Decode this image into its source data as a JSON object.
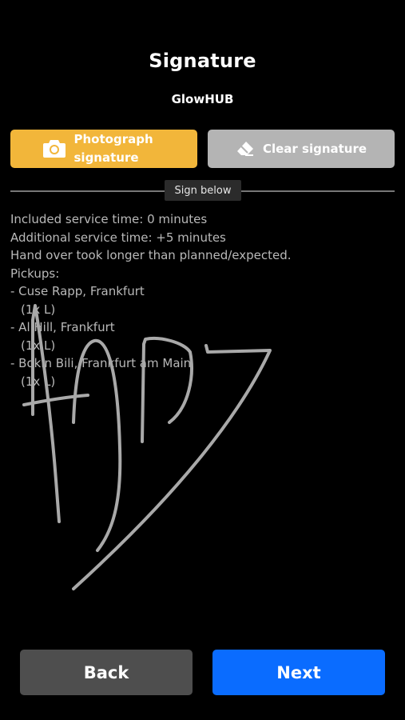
{
  "header": {
    "title": "Signature",
    "subtitle": "GlowHUB"
  },
  "actions": {
    "photograph_label": "Photograph signature",
    "clear_label": "Clear signature",
    "photograph_icon": "camera-icon",
    "clear_icon": "eraser-icon",
    "photograph_color": "#f2b63a",
    "clear_color": "#b4b4b4"
  },
  "divider": {
    "label": "Sign below"
  },
  "notes": {
    "lines": [
      "Included service time: 0 minutes",
      "Additional service time: +5 minutes",
      "Hand over took longer than planned/expected.",
      "Pickups:",
      "- Cuse Rapp, Frankfurt",
      "(1x L)",
      "- Al Hill, Frankfurt",
      "(1x L)",
      "- Bokin Bili, Frankfurt am Main",
      "(1x L)"
    ]
  },
  "footer": {
    "back_label": "Back",
    "next_label": "Next",
    "back_color": "#4e4e4e",
    "next_color": "#0a6cff"
  }
}
